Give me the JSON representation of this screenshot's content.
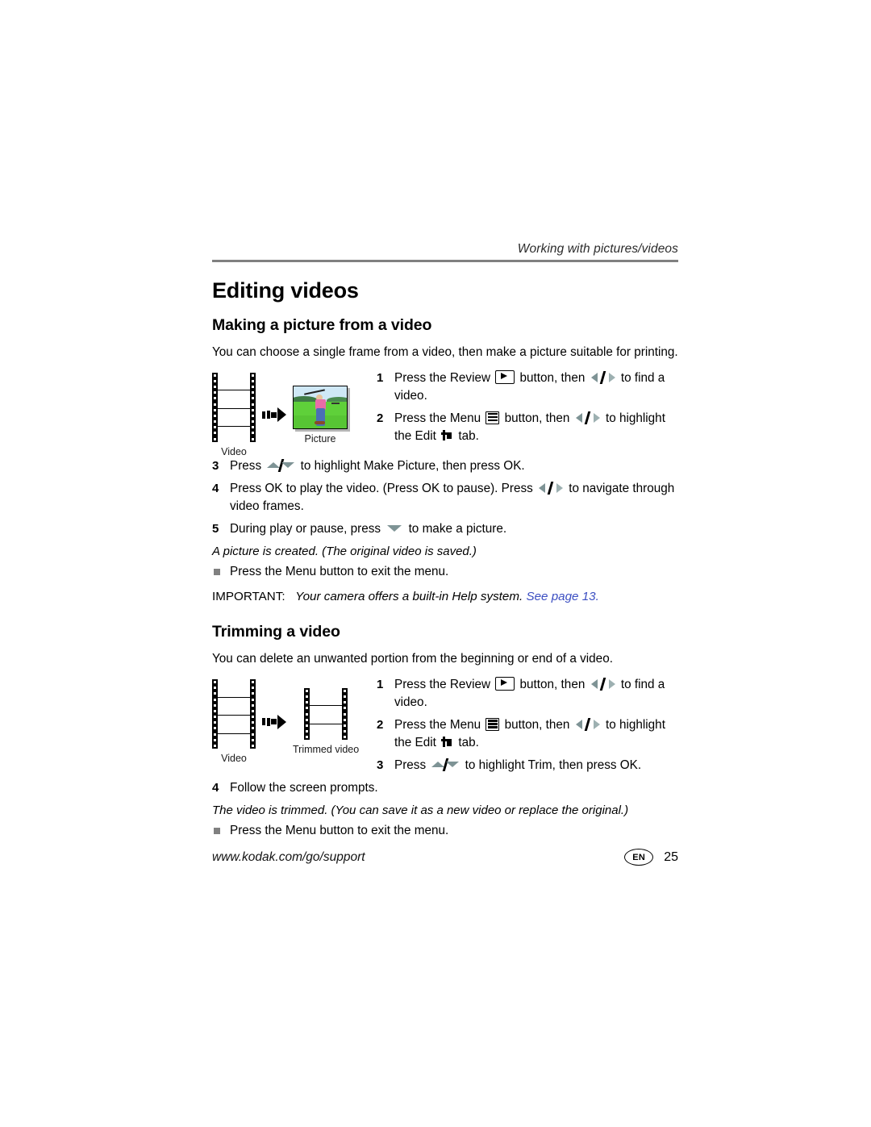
{
  "header": {
    "running_head": "Working with pictures/videos"
  },
  "chapter_title": "Editing videos",
  "sections": [
    {
      "heading": "Making a picture from a video",
      "intro": "You can choose a single frame from a video, then make a picture suitable for printing.",
      "figure": {
        "left_caption": "Video",
        "right_caption": "Picture"
      },
      "steps": [
        {
          "num": "1",
          "parts": [
            "Press the Review ",
            "review-button-icon",
            " button, then ",
            "left-right-arrows-icon",
            " to find a video."
          ]
        },
        {
          "num": "2",
          "parts": [
            "Press the Menu ",
            "menu-icon",
            " button, then ",
            "left-right-arrows-icon",
            " to highlight the Edit ",
            "edit-tab-icon",
            " tab."
          ]
        },
        {
          "num": "3",
          "parts": [
            "Press ",
            "up-down-arrows-icon",
            " to highlight Make Picture, then press OK."
          ]
        },
        {
          "num": "4",
          "parts": [
            "Press OK to play the video. (Press OK to pause). Press ",
            "left-right-arrows-icon",
            " to navigate through video frames."
          ]
        },
        {
          "num": "5",
          "parts": [
            "During play or pause, press ",
            "down-arrow-icon",
            " to make a picture."
          ]
        }
      ],
      "step_text": {
        "s1_a": "Press the Review",
        "s1_b": "button, then",
        "s1_c": "to find a",
        "s1_d": "video.",
        "s2_a": "Press the Menu",
        "s2_b": "button, then",
        "s2_c": "to highlight",
        "s2_d": "the Edit",
        "s2_e": "tab.",
        "s3_a": "Press",
        "s3_b": "to highlight Make Picture, then press OK.",
        "s4_a": "Press OK to play the video. (Press OK to pause). Press",
        "s4_b": "to navigate through video frames.",
        "s5_a": "During play or pause, press",
        "s5_b": "to make a picture."
      },
      "result_note": "A picture is created. (The original video is saved.)",
      "bullet": "Press the Menu button to exit the menu."
    },
    {
      "heading": "Trimming a video",
      "intro": "You can delete an unwanted portion from the beginning or end of a video.",
      "figure": {
        "left_caption": "Video",
        "right_caption": "Trimmed video"
      },
      "step_text": {
        "s1_a": "Press the Review",
        "s1_b": "button, then",
        "s1_c": "to find a",
        "s1_d": "video.",
        "s2_a": "Press the Menu",
        "s2_b": "button, then",
        "s2_c": "to highlight",
        "s2_d": "the Edit",
        "s2_e": "tab.",
        "s3_a": "Press",
        "s3_b": "to highlight Trim, then press OK.",
        "s4_a": "Follow the screen prompts."
      },
      "result_note": "The video is trimmed. (You can save it as a new video or replace the original.)",
      "bullet": "Press the Menu button to exit the menu."
    }
  ],
  "important": {
    "label": "IMPORTANT:",
    "body": "Your camera offers a built-in Help system.",
    "link": "See page 13."
  },
  "step_numbers": {
    "n1": "1",
    "n2": "2",
    "n3": "3",
    "n4": "4",
    "n5": "5"
  },
  "footer": {
    "url": "www.kodak.com/go/support",
    "language": "EN",
    "page_number": "25"
  },
  "colors": {
    "rule": "#808080",
    "arrow_glyph": "#7e9395",
    "link": "#3b4ec2",
    "bullet": "#808080"
  }
}
